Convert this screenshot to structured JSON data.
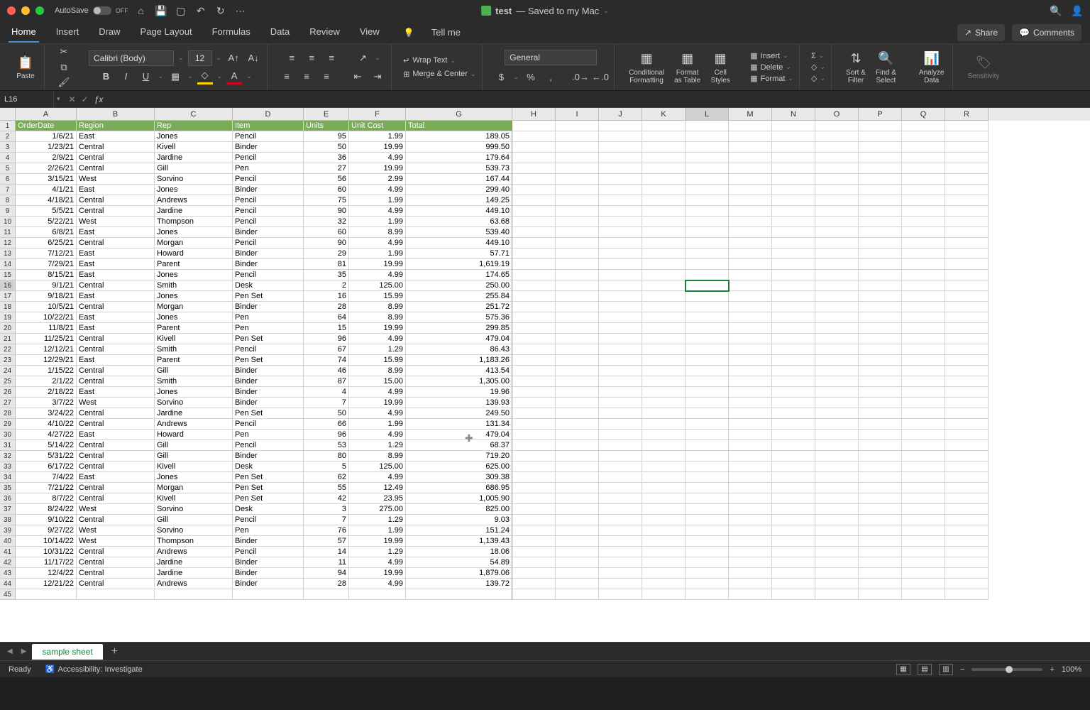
{
  "title": {
    "autosave": "AutoSave",
    "autosave_state": "OFF",
    "doc_name": "test",
    "saved": "— Saved to my Mac"
  },
  "tabs": [
    "Home",
    "Insert",
    "Draw",
    "Page Layout",
    "Formulas",
    "Data",
    "Review",
    "View"
  ],
  "tellme": "Tell me",
  "share": "Share",
  "comments": "Comments",
  "ribbon": {
    "paste": "Paste",
    "font_name": "Calibri (Body)",
    "font_size": "12",
    "wrap": "Wrap Text",
    "merge": "Merge & Center",
    "number_format": "General",
    "cond_fmt": "Conditional\nFormatting",
    "fmt_table": "Format\nas Table",
    "cell_styles": "Cell\nStyles",
    "insert": "Insert",
    "delete": "Delete",
    "format": "Format",
    "sort": "Sort &\nFilter",
    "find": "Find &\nSelect",
    "analyze": "Analyze\nData",
    "sensitivity": "Sensitivity"
  },
  "namebox": "L16",
  "columns_shown": [
    "A",
    "B",
    "C",
    "D",
    "E",
    "F",
    "G",
    "H",
    "I",
    "J",
    "K",
    "L",
    "M",
    "N",
    "O",
    "P",
    "Q",
    "R"
  ],
  "headers": [
    "OrderDate",
    "Region",
    "Rep",
    "Item",
    "Units",
    "Unit Cost",
    "Total"
  ],
  "rows": [
    [
      "1/6/21",
      "East",
      "Jones",
      "Pencil",
      "95",
      "1.99",
      "189.05"
    ],
    [
      "1/23/21",
      "Central",
      "Kivell",
      "Binder",
      "50",
      "19.99",
      "999.50"
    ],
    [
      "2/9/21",
      "Central",
      "Jardine",
      "Pencil",
      "36",
      "4.99",
      "179.64"
    ],
    [
      "2/26/21",
      "Central",
      "Gill",
      "Pen",
      "27",
      "19.99",
      "539.73"
    ],
    [
      "3/15/21",
      "West",
      "Sorvino",
      "Pencil",
      "56",
      "2.99",
      "167.44"
    ],
    [
      "4/1/21",
      "East",
      "Jones",
      "Binder",
      "60",
      "4.99",
      "299.40"
    ],
    [
      "4/18/21",
      "Central",
      "Andrews",
      "Pencil",
      "75",
      "1.99",
      "149.25"
    ],
    [
      "5/5/21",
      "Central",
      "Jardine",
      "Pencil",
      "90",
      "4.99",
      "449.10"
    ],
    [
      "5/22/21",
      "West",
      "Thompson",
      "Pencil",
      "32",
      "1.99",
      "63.68"
    ],
    [
      "6/8/21",
      "East",
      "Jones",
      "Binder",
      "60",
      "8.99",
      "539.40"
    ],
    [
      "6/25/21",
      "Central",
      "Morgan",
      "Pencil",
      "90",
      "4.99",
      "449.10"
    ],
    [
      "7/12/21",
      "East",
      "Howard",
      "Binder",
      "29",
      "1.99",
      "57.71"
    ],
    [
      "7/29/21",
      "East",
      "Parent",
      "Binder",
      "81",
      "19.99",
      "1,619.19"
    ],
    [
      "8/15/21",
      "East",
      "Jones",
      "Pencil",
      "35",
      "4.99",
      "174.65"
    ],
    [
      "9/1/21",
      "Central",
      "Smith",
      "Desk",
      "2",
      "125.00",
      "250.00"
    ],
    [
      "9/18/21",
      "East",
      "Jones",
      "Pen Set",
      "16",
      "15.99",
      "255.84"
    ],
    [
      "10/5/21",
      "Central",
      "Morgan",
      "Binder",
      "28",
      "8.99",
      "251.72"
    ],
    [
      "10/22/21",
      "East",
      "Jones",
      "Pen",
      "64",
      "8.99",
      "575.36"
    ],
    [
      "11/8/21",
      "East",
      "Parent",
      "Pen",
      "15",
      "19.99",
      "299.85"
    ],
    [
      "11/25/21",
      "Central",
      "Kivell",
      "Pen Set",
      "96",
      "4.99",
      "479.04"
    ],
    [
      "12/12/21",
      "Central",
      "Smith",
      "Pencil",
      "67",
      "1.29",
      "86.43"
    ],
    [
      "12/29/21",
      "East",
      "Parent",
      "Pen Set",
      "74",
      "15.99",
      "1,183.26"
    ],
    [
      "1/15/22",
      "Central",
      "Gill",
      "Binder",
      "46",
      "8.99",
      "413.54"
    ],
    [
      "2/1/22",
      "Central",
      "Smith",
      "Binder",
      "87",
      "15.00",
      "1,305.00"
    ],
    [
      "2/18/22",
      "East",
      "Jones",
      "Binder",
      "4",
      "4.99",
      "19.96"
    ],
    [
      "3/7/22",
      "West",
      "Sorvino",
      "Binder",
      "7",
      "19.99",
      "139.93"
    ],
    [
      "3/24/22",
      "Central",
      "Jardine",
      "Pen Set",
      "50",
      "4.99",
      "249.50"
    ],
    [
      "4/10/22",
      "Central",
      "Andrews",
      "Pencil",
      "66",
      "1.99",
      "131.34"
    ],
    [
      "4/27/22",
      "East",
      "Howard",
      "Pen",
      "96",
      "4.99",
      "479.04"
    ],
    [
      "5/14/22",
      "Central",
      "Gill",
      "Pencil",
      "53",
      "1.29",
      "68.37"
    ],
    [
      "5/31/22",
      "Central",
      "Gill",
      "Binder",
      "80",
      "8.99",
      "719.20"
    ],
    [
      "6/17/22",
      "Central",
      "Kivell",
      "Desk",
      "5",
      "125.00",
      "625.00"
    ],
    [
      "7/4/22",
      "East",
      "Jones",
      "Pen Set",
      "62",
      "4.99",
      "309.38"
    ],
    [
      "7/21/22",
      "Central",
      "Morgan",
      "Pen Set",
      "55",
      "12.49",
      "686.95"
    ],
    [
      "8/7/22",
      "Central",
      "Kivell",
      "Pen Set",
      "42",
      "23.95",
      "1,005.90"
    ],
    [
      "8/24/22",
      "West",
      "Sorvino",
      "Desk",
      "3",
      "275.00",
      "825.00"
    ],
    [
      "9/10/22",
      "Central",
      "Gill",
      "Pencil",
      "7",
      "1.29",
      "9.03"
    ],
    [
      "9/27/22",
      "West",
      "Sorvino",
      "Pen",
      "76",
      "1.99",
      "151.24"
    ],
    [
      "10/14/22",
      "West",
      "Thompson",
      "Binder",
      "57",
      "19.99",
      "1,139.43"
    ],
    [
      "10/31/22",
      "Central",
      "Andrews",
      "Pencil",
      "14",
      "1.29",
      "18.06"
    ],
    [
      "11/17/22",
      "Central",
      "Jardine",
      "Binder",
      "11",
      "4.99",
      "54.89"
    ],
    [
      "12/4/22",
      "Central",
      "Jardine",
      "Binder",
      "94",
      "19.99",
      "1,879.06"
    ],
    [
      "12/21/22",
      "Central",
      "Andrews",
      "Binder",
      "28",
      "4.99",
      "139.72"
    ]
  ],
  "selected_cell": "L16",
  "sheet_name": "sample sheet",
  "status_ready": "Ready",
  "accessibility": "Accessibility: Investigate",
  "zoom": "100%"
}
